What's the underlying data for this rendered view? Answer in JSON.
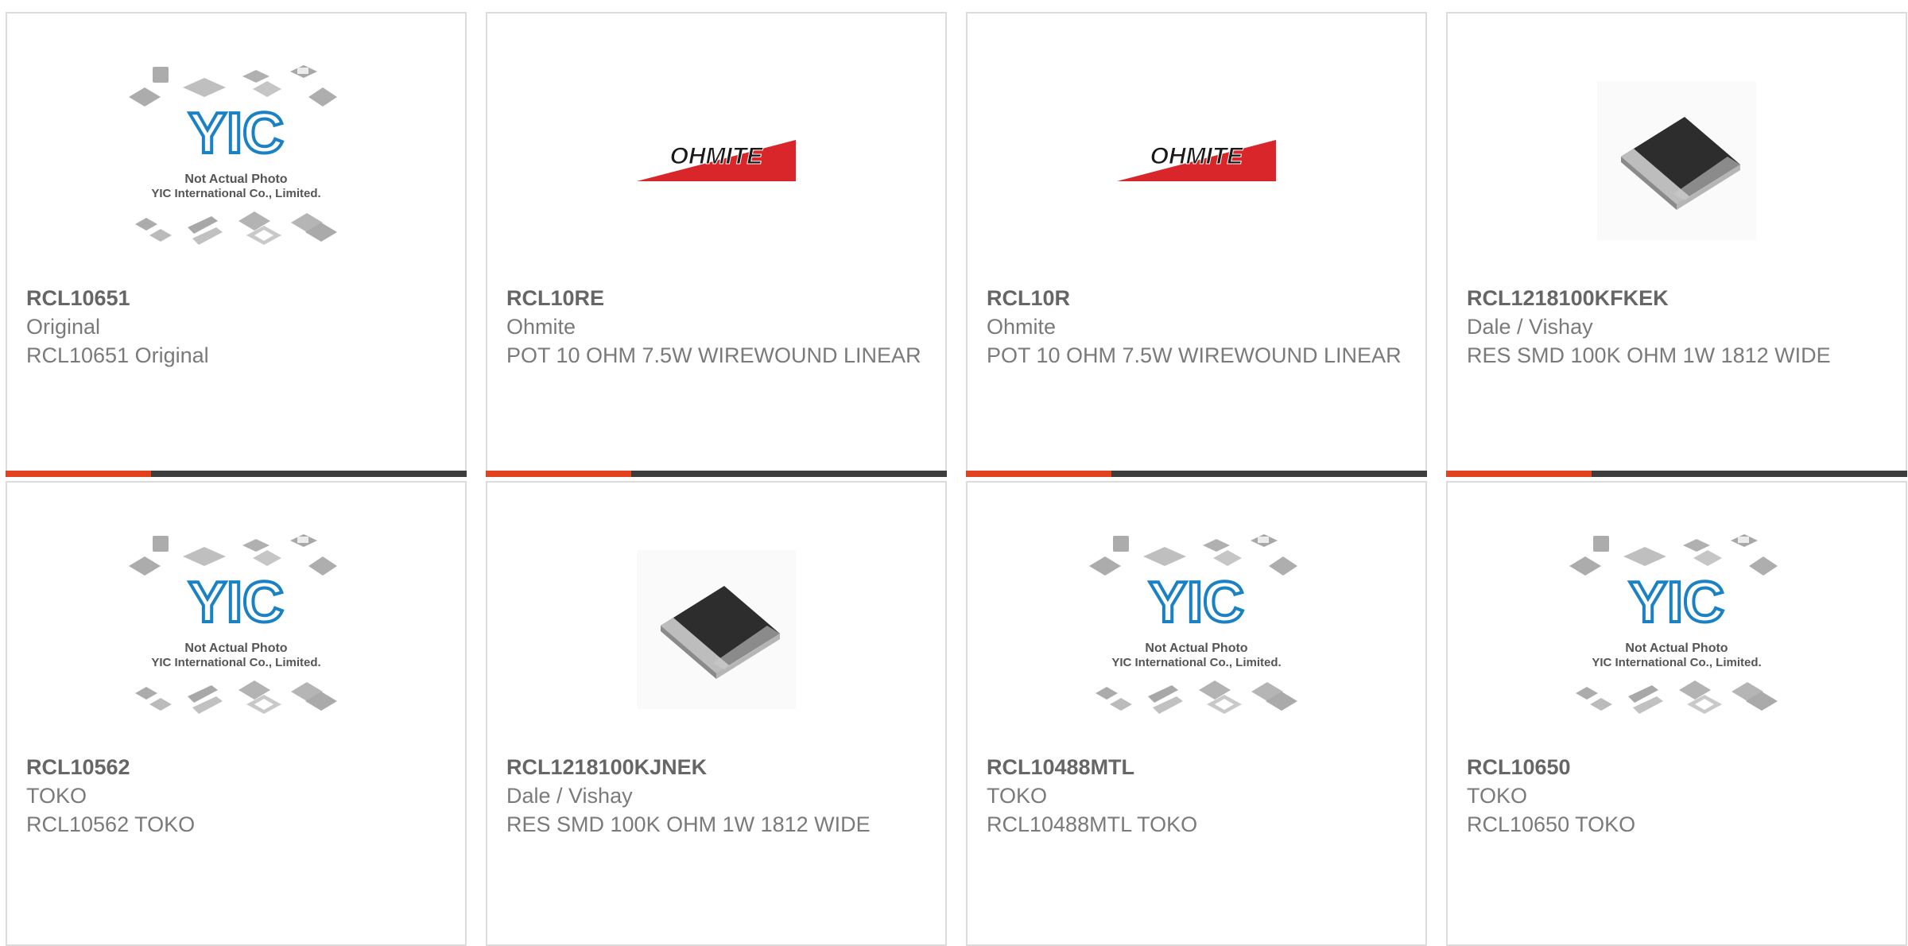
{
  "colors": {
    "accent": "#e2421e",
    "bar_dark": "#3d3d3d",
    "border": "#dcdcdc",
    "yic_blue": "#1a82c4",
    "ohmite_red": "#d8262b"
  },
  "placeholder": {
    "line1": "Not Actual Photo",
    "line2": "YIC International Co., Limited.",
    "logo": "YIC"
  },
  "brand_logo": {
    "ohmite": "OHMITE"
  },
  "products": [
    {
      "part": "RCL10651",
      "maker": "Original",
      "desc": "RCL10651 Original",
      "image": "yic-placeholder"
    },
    {
      "part": "RCL10RE",
      "maker": "Ohmite",
      "desc": "POT 10 OHM 7.5W WIREWOUND LINEAR",
      "image": "ohmite-logo"
    },
    {
      "part": "RCL10R",
      "maker": "Ohmite",
      "desc": "POT 10 OHM 7.5W WIREWOUND LINEAR",
      "image": "ohmite-logo"
    },
    {
      "part": "RCL1218100KFKEK",
      "maker": "Dale / Vishay",
      "desc": "RES SMD 100K OHM 1W 1812 WIDE",
      "image": "smd-resistor-photo"
    },
    {
      "part": "RCL10562",
      "maker": "TOKO",
      "desc": "RCL10562 TOKO",
      "image": "yic-placeholder"
    },
    {
      "part": "RCL1218100KJNEK",
      "maker": "Dale / Vishay",
      "desc": "RES SMD 100K OHM 1W 1812 WIDE",
      "image": "smd-resistor-photo"
    },
    {
      "part": "RCL10488MTL",
      "maker": "TOKO",
      "desc": "RCL10488MTL TOKO",
      "image": "yic-placeholder"
    },
    {
      "part": "RCL10650",
      "maker": "TOKO",
      "desc": "RCL10650 TOKO",
      "image": "yic-placeholder"
    }
  ]
}
